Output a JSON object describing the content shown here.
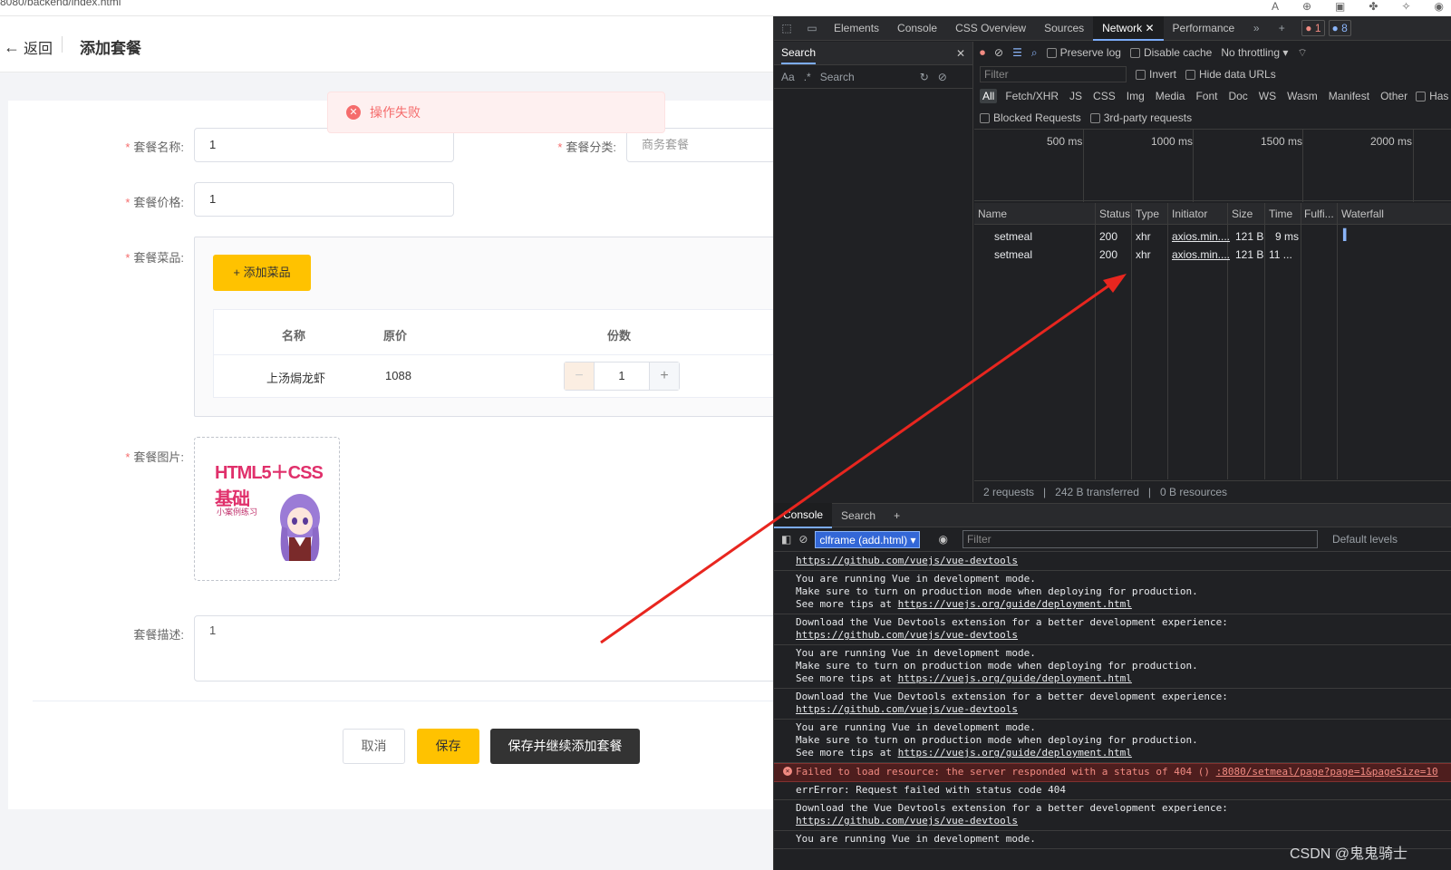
{
  "browser": {
    "url": "8080/backend/index.html"
  },
  "app": {
    "back_label": "返回",
    "page_title": "添加套餐",
    "toast": "操作失败",
    "form": {
      "name_label": "套餐名称:",
      "name_value": "1",
      "category_label": "套餐分类:",
      "category_value": "商务套餐",
      "price_label": "套餐价格:",
      "price_value": "1",
      "dishes_label": "套餐菜品:",
      "add_dish_button": "+ 添加菜品",
      "dish_table": {
        "headers": [
          "名称",
          "原价",
          "份数"
        ],
        "rows": [
          {
            "name": "上汤焗龙虾",
            "price": "1088",
            "copies": "1"
          }
        ]
      },
      "image_label": "套餐图片:",
      "image_title": "HTML5＋CSS基础",
      "image_subtitle": "小案例练习",
      "desc_label": "套餐描述:",
      "desc_value": "1"
    },
    "buttons": {
      "cancel": "取消",
      "save": "保存",
      "save_continue": "保存并继续添加套餐"
    }
  },
  "devtools": {
    "tabs": [
      "Elements",
      "Console",
      "CSS Overview",
      "Sources",
      "Network",
      "Performance"
    ],
    "active_tab": "Network",
    "error_count": "1",
    "info_count": "8",
    "search_pane": {
      "title": "Search",
      "aa": "Aa",
      "regex": ".*",
      "placeholder": "Search"
    },
    "network": {
      "preserve_log": "Preserve log",
      "disable_cache": "Disable cache",
      "throttling": "No throttling",
      "filter_placeholder": "Filter",
      "invert": "Invert",
      "hide_data_urls": "Hide data URLs",
      "types": [
        "All",
        "Fetch/XHR",
        "JS",
        "CSS",
        "Img",
        "Media",
        "Font",
        "Doc",
        "WS",
        "Wasm",
        "Manifest",
        "Other"
      ],
      "has_label": "Has",
      "blocked_requests": "Blocked Requests",
      "third_party": "3rd-party requests",
      "ticks": [
        "500 ms",
        "1000 ms",
        "1500 ms",
        "2000 ms"
      ],
      "columns": [
        "Name",
        "Status",
        "Type",
        "Initiator",
        "Size",
        "Time",
        "Fulfi...",
        "Waterfall"
      ],
      "requests": [
        {
          "name": "setmeal",
          "status": "200",
          "type": "xhr",
          "initiator": "axios.min....",
          "size": "121 B",
          "time": "9 ms"
        },
        {
          "name": "setmeal",
          "status": "200",
          "type": "xhr",
          "initiator": "axios.min....",
          "size": "121 B",
          "time": "11 ..."
        }
      ],
      "summary": {
        "requests": "2 requests",
        "transferred": "242 B transferred",
        "resources": "0 B resources"
      }
    },
    "console": {
      "tabs": [
        "Console",
        "Search"
      ],
      "context": "clframe (add.html)",
      "filter_placeholder": "Filter",
      "levels": "Default levels",
      "logs": [
        {
          "kind": "info",
          "text": "https://github.com/vuejs/vue-devtools"
        },
        {
          "kind": "info",
          "text": "You are running Vue in development mode.\nMake sure to turn on production mode when deploying for production.\nSee more tips at https://vuejs.org/guide/deployment.html"
        },
        {
          "kind": "info",
          "text": "Download the Vue Devtools extension for a better development experience:\nhttps://github.com/vuejs/vue-devtools"
        },
        {
          "kind": "info",
          "text": "You are running Vue in development mode.\nMake sure to turn on production mode when deploying for production.\nSee more tips at https://vuejs.org/guide/deployment.html"
        },
        {
          "kind": "info",
          "text": "Download the Vue Devtools extension for a better development experience:\nhttps://github.com/vuejs/vue-devtools"
        },
        {
          "kind": "info",
          "text": "You are running Vue in development mode.\nMake sure to turn on production mode when deploying for production.\nSee more tips at https://vuejs.org/guide/deployment.html"
        },
        {
          "kind": "error",
          "text": "Failed to load resource: the server responded with a status of 404 ()",
          "source": ":8080/setmeal/page?page=1&pageSize=10"
        },
        {
          "kind": "info",
          "text": "errError: Request failed with status code 404"
        },
        {
          "kind": "info",
          "text": "Download the Vue Devtools extension for a better development experience:\nhttps://github.com/vuejs/vue-devtools"
        },
        {
          "kind": "info",
          "text": "You are running Vue in development mode."
        }
      ]
    }
  },
  "watermark": "CSDN @鬼鬼骑士",
  "colors": {
    "accent_yellow": "#ffc200",
    "error_red": "#f56c6c",
    "annotation_arrow": "#e8261f"
  }
}
